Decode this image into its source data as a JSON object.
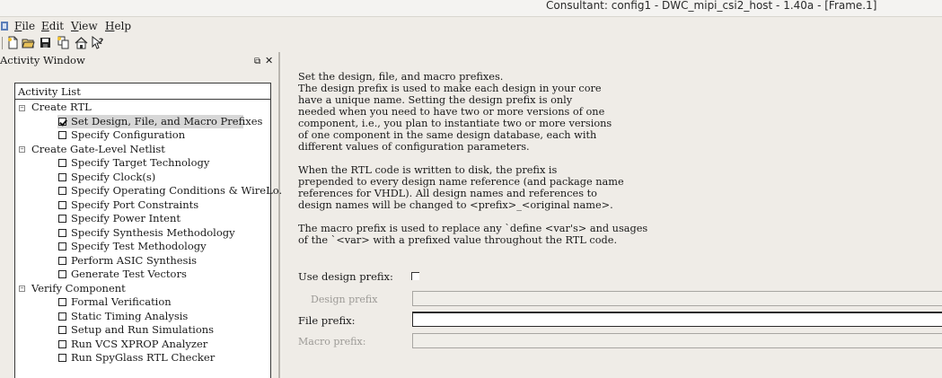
{
  "window": {
    "title": "Consultant: config1 - DWC_mipi_csi2_host - 1.40a - [Frame.1]"
  },
  "menubar": {
    "items": [
      "File",
      "Edit",
      "View",
      "Help"
    ]
  },
  "toolbar": {
    "icons": [
      "new-icon",
      "open-icon",
      "save-icon",
      "copy-icon",
      "home-icon",
      "context-help-icon"
    ]
  },
  "activity_window": {
    "title": "Activity Window",
    "list_header": "Activity List",
    "groups": [
      {
        "label": "Create RTL",
        "expander": "−",
        "items": [
          {
            "label": "Set Design, File, and Macro Prefixes",
            "checked": true,
            "selected": true
          },
          {
            "label": "Specify Configuration",
            "checked": false
          }
        ]
      },
      {
        "label": "Create Gate-Level Netlist",
        "expander": "−",
        "items": [
          {
            "label": "Specify Target Technology",
            "checked": false
          },
          {
            "label": "Specify Clock(s)",
            "checked": false
          },
          {
            "label": "Specify Operating Conditions & WireLo...",
            "checked": false
          },
          {
            "label": "Specify Port Constraints",
            "checked": false
          },
          {
            "label": "Specify Power Intent",
            "checked": false
          },
          {
            "label": "Specify Synthesis Methodology",
            "checked": false
          },
          {
            "label": "Specify Test Methodology",
            "checked": false
          },
          {
            "label": "Perform ASIC Synthesis",
            "checked": false
          },
          {
            "label": "Generate Test Vectors",
            "checked": false
          }
        ]
      },
      {
        "label": "Verify Component",
        "expander": "−",
        "items": [
          {
            "label": "Formal Verification",
            "checked": false
          },
          {
            "label": "Static Timing Analysis",
            "checked": false
          },
          {
            "label": "Setup and Run Simulations",
            "checked": false
          },
          {
            "label": "Run VCS XPROP Analyzer",
            "checked": false
          },
          {
            "label": "Run SpyGlass RTL Checker",
            "checked": false
          }
        ]
      }
    ]
  },
  "content": {
    "description_lines": [
      "Set the design, file, and macro prefixes.",
      "The design prefix is used to make each design in your core",
      "have a unique name.  Setting the design prefix is only",
      "needed when you need to have two or more versions of one",
      "component, i.e., you plan to instantiate two or more versions",
      "of one component in the same design database, each with",
      "different values of configuration parameters.",
      "",
      "When the RTL code is written to disk, the prefix is",
      "prepended to every design name reference (and package name",
      "references for VHDL).  All design names and references to",
      "design names will be changed to <prefix>_<original name>.",
      "",
      "The macro prefix is used to replace any `define <var's> and usages",
      "of the `<var> with a prefixed value throughout the RTL code."
    ],
    "form": {
      "use_design_prefix_label": "Use design prefix:",
      "use_design_prefix_checked": false,
      "design_prefix_label": "Design prefix",
      "design_prefix_value": "",
      "file_prefix_label": "File prefix:",
      "file_prefix_value": "",
      "macro_prefix_label": "Macro prefix:",
      "macro_prefix_value": ""
    }
  }
}
